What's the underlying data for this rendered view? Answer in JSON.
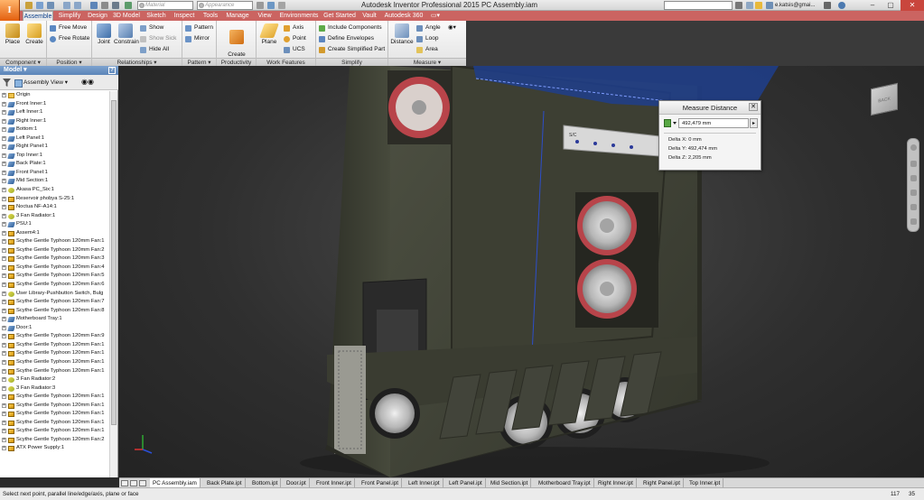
{
  "titlebar": {
    "app_button_label": "I",
    "material_placeholder": "Material",
    "appearance_placeholder": "Appearance",
    "title": "Autodesk Inventor Professional 2015   PC Assembly.iam",
    "user": "e.katsis@gmai...",
    "minimize": "–",
    "maximize": "▢",
    "close": "✕"
  },
  "menu": {
    "tabs": [
      "Assemble",
      "Simplify",
      "Design",
      "3D Model",
      "Sketch",
      "Inspect",
      "Tools",
      "Manage",
      "View",
      "Environments",
      "Get Started",
      "Vault",
      "Autodesk 360"
    ],
    "active": "Assemble"
  },
  "ribbon": {
    "panels": {
      "component": "Component ▾",
      "position": "Position ▾",
      "relationships": "Relationships ▾",
      "pattern": "Pattern ▾",
      "productivity": "Productivity",
      "work_features": "Work Features",
      "simplify": "Simplify",
      "measure": "Measure ▾"
    },
    "place": "Place",
    "create": "Create",
    "free_move": "Free Move",
    "free_rotate": "Free Rotate",
    "joint": "Joint",
    "constrain": "Constrain",
    "show": "Show",
    "show_sick": "Show Sick",
    "hide_all": "Hide All",
    "pattern": "Pattern",
    "mirror": "Mirror",
    "create_substitutes": "Create\nSubstitutes",
    "plane": "Plane",
    "axis": "Axis",
    "point": "Point",
    "ucs": "UCS",
    "include_components": "Include Components",
    "define_envelopes": "Define Envelopes",
    "create_simplified_part": "Create Simplified Part",
    "distance": "Distance",
    "angle": "Angle",
    "loop": "Loop",
    "area": "Area"
  },
  "browser": {
    "title": "Model ▾",
    "help": "?",
    "view": "Assembly View",
    "items": [
      {
        "label": "Origin",
        "type": "folder"
      },
      {
        "label": "Front Inner:1",
        "type": "part"
      },
      {
        "label": "Left Inner:1",
        "type": "part"
      },
      {
        "label": "Right Inner:1",
        "type": "part"
      },
      {
        "label": "Bottom:1",
        "type": "part"
      },
      {
        "label": "Left Panel:1",
        "type": "part"
      },
      {
        "label": "Right Panel:1",
        "type": "part"
      },
      {
        "label": "Top Inner:1",
        "type": "part"
      },
      {
        "label": "Back Plate:1",
        "type": "part"
      },
      {
        "label": "Front Panel:1",
        "type": "part"
      },
      {
        "label": "Mid Section:1",
        "type": "part"
      },
      {
        "label": "Akasa PC_Six:1",
        "type": "sub"
      },
      {
        "label": "Reservoir phobya S-25:1",
        "type": "asm"
      },
      {
        "label": "Noctua NF-A14:1",
        "type": "asm"
      },
      {
        "label": "3 Fan Radiator:1",
        "type": "sub"
      },
      {
        "label": "PSU:1",
        "type": "part"
      },
      {
        "label": "Assem4:1",
        "type": "asm"
      },
      {
        "label": "Scythe Gentle Typhoon 120mm Fan:1",
        "type": "asm"
      },
      {
        "label": "Scythe Gentle Typhoon 120mm Fan:2",
        "type": "asm"
      },
      {
        "label": "Scythe Gentle Typhoon 120mm Fan:3",
        "type": "asm"
      },
      {
        "label": "Scythe Gentle Typhoon 120mm Fan:4",
        "type": "asm"
      },
      {
        "label": "Scythe Gentle Typhoon 120mm Fan:5",
        "type": "asm"
      },
      {
        "label": "Scythe Gentle Typhoon 120mm Fan:6",
        "type": "asm"
      },
      {
        "label": "User Library-Pushbutton Switch, Bulg",
        "type": "sub"
      },
      {
        "label": "Scythe Gentle Typhoon 120mm Fan:7",
        "type": "asm"
      },
      {
        "label": "Scythe Gentle Typhoon 120mm Fan:8",
        "type": "asm"
      },
      {
        "label": "Motherboard Tray:1",
        "type": "part"
      },
      {
        "label": "Door:1",
        "type": "part"
      },
      {
        "label": "Scythe Gentle Typhoon 120mm Fan:9",
        "type": "asm"
      },
      {
        "label": "Scythe Gentle Typhoon 120mm Fan:1",
        "type": "asm"
      },
      {
        "label": "Scythe Gentle Typhoon 120mm Fan:1",
        "type": "asm"
      },
      {
        "label": "Scythe Gentle Typhoon 120mm Fan:1",
        "type": "asm"
      },
      {
        "label": "Scythe Gentle Typhoon 120mm Fan:1",
        "type": "asm"
      },
      {
        "label": "3 Fan Radiator:2",
        "type": "sub"
      },
      {
        "label": "3 Fan Radiator:3",
        "type": "sub"
      },
      {
        "label": "Scythe Gentle Typhoon 120mm Fan:1",
        "type": "asm"
      },
      {
        "label": "Scythe Gentle Typhoon 120mm Fan:1",
        "type": "asm"
      },
      {
        "label": "Scythe Gentle Typhoon 120mm Fan:1",
        "type": "asm"
      },
      {
        "label": "Scythe Gentle Typhoon 120mm Fan:1",
        "type": "asm"
      },
      {
        "label": "Scythe Gentle Typhoon 120mm Fan:1",
        "type": "asm"
      },
      {
        "label": "Scythe Gentle Typhoon 120mm Fan:2",
        "type": "asm"
      },
      {
        "label": "ATX Power Supply:1",
        "type": "asm"
      }
    ]
  },
  "viewcube": {
    "label": "BACK"
  },
  "measure": {
    "title": "Measure Distance",
    "close": "✕",
    "value": "492,479 mm",
    "arrow": "▸",
    "delta_x": "Delta X: 0 mm",
    "delta_y": "Delta Y: 492,474 mm",
    "delta_z": "Delta Z: 2,205 mm"
  },
  "doc_tabs": {
    "items": [
      "PC Assembly.iam",
      "Back Plate.ipt",
      "Bottom.ipt",
      "Door.ipt",
      "Front Inner.ipt",
      "Front Panel.ipt",
      "Left Inner.ipt",
      "Left Panel.ipt",
      "Mid Section.ipt",
      "Motherboard Tray.ipt",
      "Right Inner.ipt",
      "Right Panel.ipt",
      "Top Inner.ipt"
    ],
    "active": "PC Assembly.iam"
  },
  "status": {
    "text": "Select next point, parallel line/edge/axis, plane or face",
    "n1": "117",
    "n2": "35"
  },
  "colors": {
    "menubar": "#cb6461",
    "accent": "#e25c0b",
    "case": "#3f4135",
    "fan": "#b8444a"
  }
}
